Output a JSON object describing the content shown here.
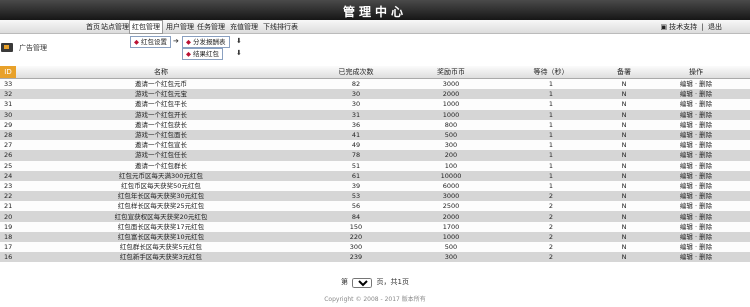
{
  "app_title": "管理中心",
  "nav": {
    "items": [
      "首页",
      "站点管理",
      "红包管理",
      "用户管理",
      "任务管理",
      "充值管理",
      "下线排行表"
    ],
    "user_label": "技术支持",
    "logout_label": "退出"
  },
  "breadcrumb": {
    "title": "广告管理"
  },
  "submenu": {
    "item1": "红包设置",
    "item2": "分发报酬表",
    "item3": "结果红包"
  },
  "table": {
    "corner": "ID",
    "headers": [
      "名称",
      "已完成次数",
      "奖励币币",
      "等待（秒）",
      "备署",
      "操作"
    ],
    "rows": [
      [
        "33",
        "邀请一个红包元币",
        "82",
        "3000",
        "1",
        "N"
      ],
      [
        "32",
        "游戏一个红包元宝",
        "30",
        "2000",
        "1",
        "N"
      ],
      [
        "31",
        "邀请一个红包平长",
        "30",
        "1000",
        "1",
        "N"
      ],
      [
        "30",
        "游戏一个红包开长",
        "31",
        "1000",
        "1",
        "N"
      ],
      [
        "29",
        "邀请一个红包获长",
        "36",
        "800",
        "1",
        "N"
      ],
      [
        "28",
        "游戏一个红包面长",
        "41",
        "500",
        "1",
        "N"
      ],
      [
        "27",
        "邀请一个红包宣长",
        "49",
        "300",
        "1",
        "N"
      ],
      [
        "26",
        "游戏一个红包任长",
        "78",
        "200",
        "1",
        "N"
      ],
      [
        "25",
        "邀请一个红包群长",
        "51",
        "100",
        "1",
        "N"
      ],
      [
        "24",
        "红包元币区每天满300元红包",
        "61",
        "10000",
        "1",
        "N"
      ],
      [
        "23",
        "红包币区每天获奖50元红包",
        "39",
        "6000",
        "1",
        "N"
      ],
      [
        "22",
        "红包年长区每天获奖30元红包",
        "53",
        "3000",
        "2",
        "N"
      ],
      [
        "21",
        "红包样长区每天获奖25元红包",
        "56",
        "2500",
        "2",
        "N"
      ],
      [
        "20",
        "红包宣获权区每天获奖20元红包",
        "84",
        "2000",
        "2",
        "N"
      ],
      [
        "19",
        "红包面长区每天获奖17元红包",
        "150",
        "1700",
        "2",
        "N"
      ],
      [
        "18",
        "红包富长区每天获奖10元红包",
        "220",
        "1000",
        "2",
        "N"
      ],
      [
        "17",
        "红包群长区每天获奖5元红包",
        "300",
        "500",
        "2",
        "N"
      ],
      [
        "16",
        "红包新手区每天获奖3元红包",
        "239",
        "300",
        "2",
        "N"
      ]
    ],
    "edit_label": "编辑",
    "delete_label": "删除"
  },
  "pager": {
    "prefix": "第",
    "page_value": "1",
    "suffix": "页，共1页"
  },
  "footer": "Copyright © 2008 - 2017 版本所有",
  "colors": {
    "topbar": "#161616",
    "accent": "#e8a12a",
    "row_alt": "#d6d6d6"
  }
}
